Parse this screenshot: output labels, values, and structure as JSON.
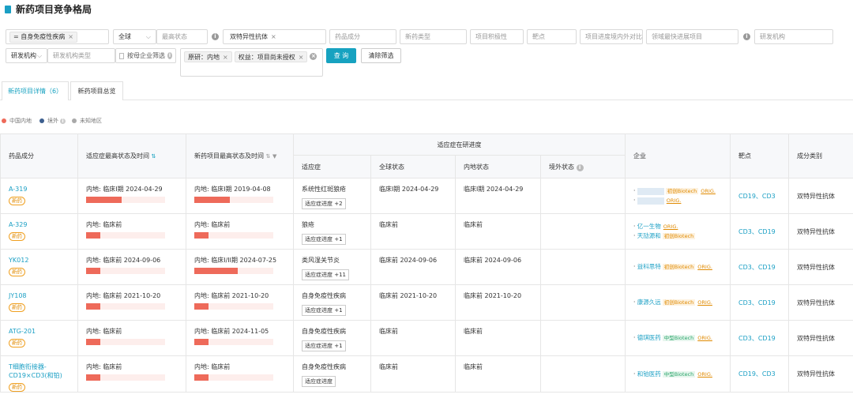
{
  "page": {
    "title": "新药项目竞争格局"
  },
  "filters": {
    "disease_tag": "= 自身免疫性疾病",
    "region_select": "全球",
    "max_status_placeholder": "最高状态",
    "modality_tag": "双特异性抗体",
    "drug_component_placeholder": "药品成分",
    "drug_type_placeholder": "新药类型",
    "project_activity_placeholder": "项目积极性",
    "target_placeholder": "靶点",
    "progress_compare_placeholder": "项目进度境内外对比",
    "fastest_field_placeholder": "领域最快进展项目",
    "rd_org_placeholder": "研发机构",
    "rd_org_label": "研发机构",
    "rd_org_type_placeholder": "研发机构类型",
    "parent_filter_label": "按母企业筛选",
    "origin_tag": "原研：内地",
    "rights_tag": "权益：项目尚未授权",
    "query_button": "查 询",
    "clear_button": "清除筛选"
  },
  "tabs": [
    {
      "label": "新药项目详情（6）"
    },
    {
      "label": "新药项目总览"
    }
  ],
  "legend": [
    {
      "label": "中国内地",
      "color": "#ee6a5a"
    },
    {
      "label": "境外",
      "color": "#3d5f8f"
    },
    {
      "label": "未知地区",
      "color": "#a9a9a9"
    }
  ],
  "table": {
    "headers": {
      "component": "药品成分",
      "indication_status": "适应症最高状态及时间",
      "project_status": "新药项目最高状态及时间",
      "group": "适应症在研进度",
      "indication": "适应症",
      "global_status": "全球状态",
      "domestic_status": "内地状态",
      "overseas_status": "境外状态",
      "company": "企业",
      "target": "靶点",
      "category": "成分类别"
    },
    "rows": [
      {
        "name": "A-319",
        "badge": "新药",
        "ind_status": "内地: 临床I期 2024-04-29",
        "ind_fill": 0.45,
        "proj_status": "内地: 临床I期 2019-04-08",
        "proj_fill": 0.45,
        "indication": "系统性红斑狼疮",
        "progress": "适应症进度 +2",
        "global": "临床I期 2024-04-29",
        "domestic": "临床I期 2024-04-29",
        "overseas": "",
        "companies": [
          {
            "name": "",
            "tag": "初创Biotech",
            "orig": "ORIG."
          },
          {
            "name": "",
            "tag": "",
            "orig": "ORIG."
          }
        ],
        "target": "CD19、CD3",
        "category": "双特异性抗体"
      },
      {
        "name": "A-329",
        "badge": "新药",
        "ind_status": "内地: 临床前",
        "ind_fill": 0.18,
        "proj_status": "内地: 临床前",
        "proj_fill": 0.18,
        "indication": "狼疮",
        "progress": "适应症进度 +1",
        "global": "临床前",
        "domestic": "临床前",
        "overseas": "",
        "companies": [
          {
            "name": "亿一生物",
            "tag": "",
            "orig": "ORIG."
          },
          {
            "name": "天劢源和",
            "tag": "初创Biotech",
            "orig": ""
          }
        ],
        "target": "CD3、CD19",
        "category": "双特异性抗体"
      },
      {
        "name": "YK012",
        "badge": "新药",
        "ind_status": "内地: 临床前 2024-09-06",
        "ind_fill": 0.18,
        "proj_status": "内地: 临床I/II期 2024-07-25",
        "proj_fill": 0.55,
        "indication": "类风湿关节炎",
        "progress": "适应症进度 +11",
        "global": "临床前 2024-09-06",
        "domestic": "临床前 2024-09-06",
        "overseas": "",
        "companies": [
          {
            "name": "益科思特",
            "tag": "初创Biotech",
            "orig": "ORIG."
          }
        ],
        "target": "CD3、CD19",
        "category": "双特异性抗体"
      },
      {
        "name": "JY108",
        "badge": "新药",
        "ind_status": "内地: 临床前 2021-10-20",
        "ind_fill": 0.18,
        "proj_status": "内地: 临床前 2021-10-20",
        "proj_fill": 0.18,
        "indication": "自身免疫性疾病",
        "progress": "适应症进度 +1",
        "global": "临床前 2021-10-20",
        "domestic": "临床前 2021-10-20",
        "overseas": "",
        "companies": [
          {
            "name": "康源久远",
            "tag": "初创Biotech",
            "orig": "ORIG."
          }
        ],
        "target": "CD3、CD19",
        "category": "双特异性抗体"
      },
      {
        "name": "ATG-201",
        "badge": "新药",
        "ind_status": "内地: 临床前",
        "ind_fill": 0.18,
        "proj_status": "内地: 临床前 2024-11-05",
        "proj_fill": 0.18,
        "indication": "自身免疫性疾病",
        "progress": "适应症进度 +1",
        "global": "临床前",
        "domestic": "临床前",
        "overseas": "",
        "companies": [
          {
            "name": "德琪医药",
            "tag": "中型Biotech",
            "orig": "ORIG."
          }
        ],
        "target": "CD3、CD19",
        "category": "双特异性抗体"
      },
      {
        "name": "T细胞衔接器-CD19×CD3(和铂)",
        "badge": "新药",
        "ind_status": "内地: 临床前",
        "ind_fill": 0.18,
        "proj_status": "内地: 临床前",
        "proj_fill": 0.18,
        "indication": "自身免疫性疾病",
        "progress": "适应症进度",
        "global": "临床前",
        "domestic": "临床前",
        "overseas": "",
        "companies": [
          {
            "name": "和铂医药",
            "tag": "中型Biotech",
            "orig": "ORIG."
          }
        ],
        "target": "CD19、CD3",
        "category": "双特异性抗体"
      }
    ]
  }
}
